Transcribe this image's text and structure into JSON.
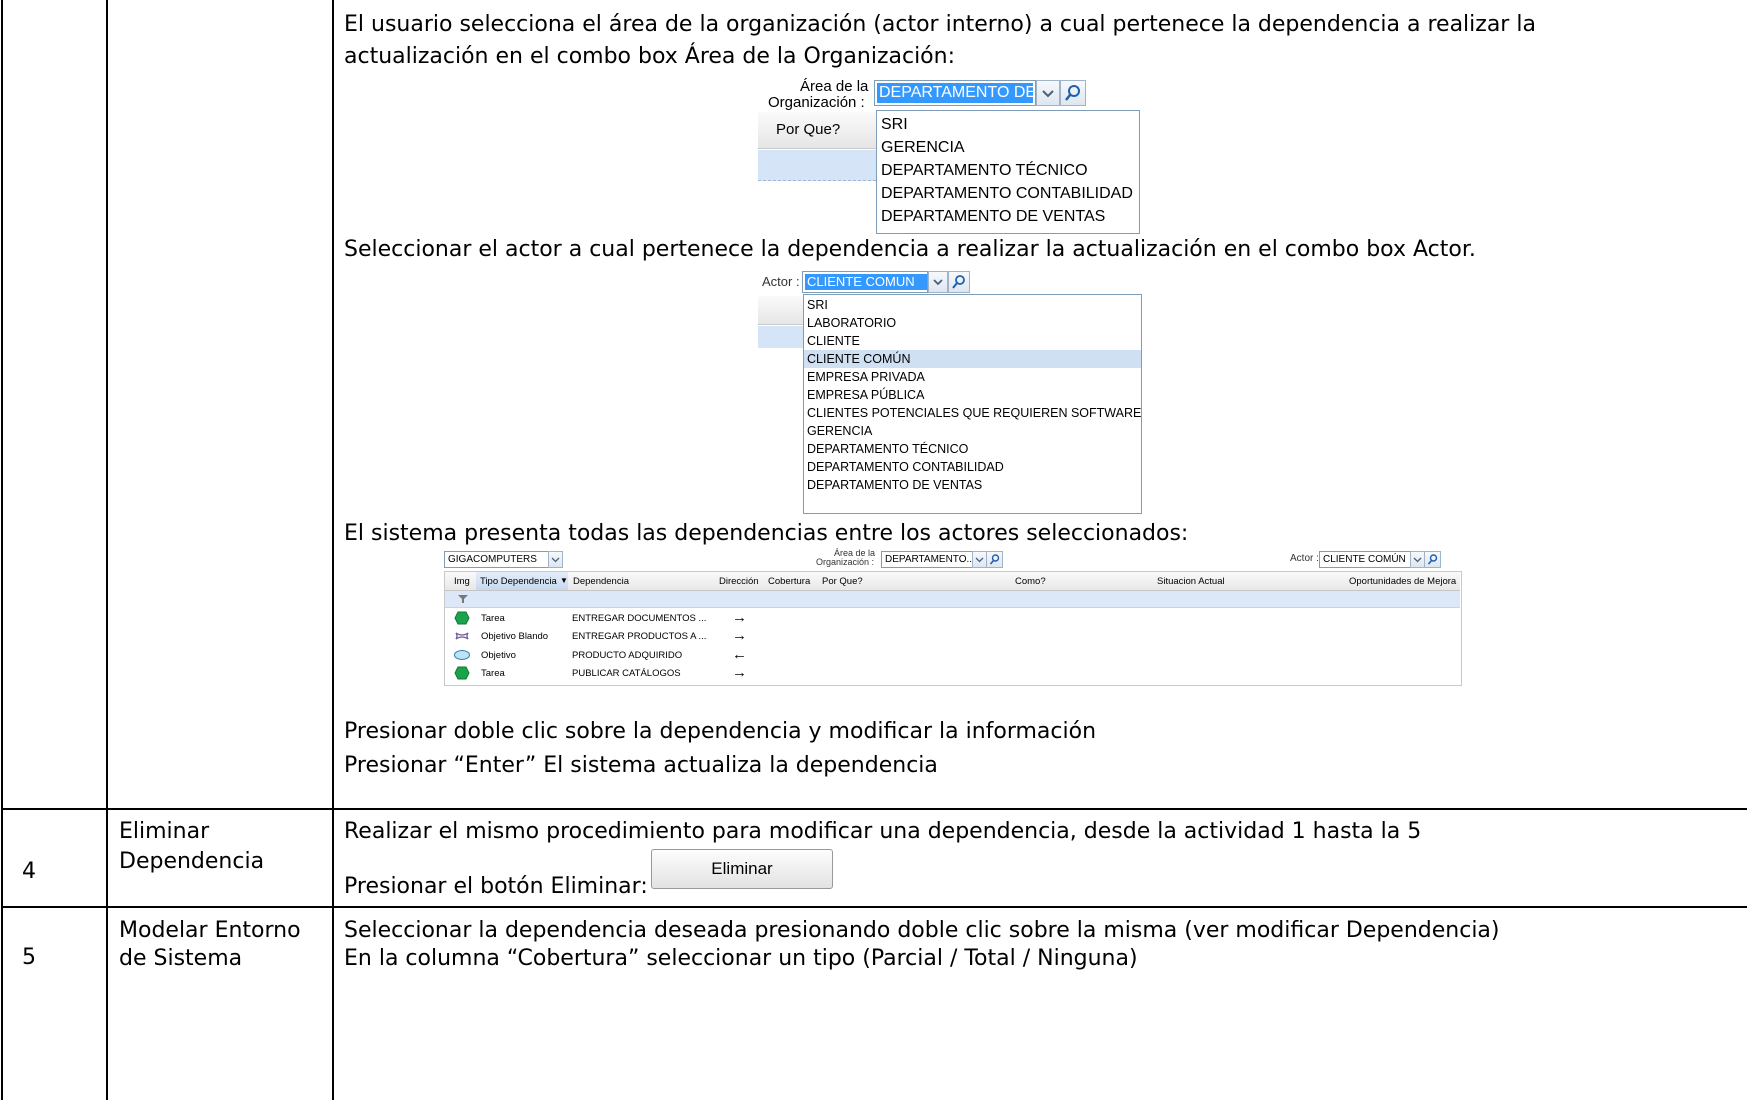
{
  "row3": {
    "para1_line1": "El usuario selecciona el área de la organización (actor interno) a cual pertenece la dependencia a realizar la",
    "para1_line2": "actualización en el combo box Área de la Organización:",
    "area_combo": {
      "label_line1": "Área de la",
      "label_line2": "Organización :",
      "value": "DEPARTAMENTO DE",
      "column_header": "Por Que?",
      "options": [
        "SRI",
        "GERENCIA",
        "DEPARTAMENTO TÉCNICO",
        "DEPARTAMENTO CONTABILIDAD",
        "DEPARTAMENTO DE VENTAS"
      ]
    },
    "para2": "Seleccionar el actor a cual pertenece la dependencia a realizar la actualización en el combo box Actor.",
    "actor_combo": {
      "label": "Actor :",
      "value": "CLIENTE COMUN",
      "options": [
        "SRI",
        "LABORATORIO",
        "CLIENTE",
        "CLIENTE COMÚN",
        "EMPRESA PRIVADA",
        "EMPRESA PÚBLICA",
        "CLIENTES POTENCIALES QUE REQUIEREN SOFTWARE",
        "GERENCIA",
        "DEPARTAMENTO TÉCNICO",
        "DEPARTAMENTO CONTABILIDAD",
        "DEPARTAMENTO DE VENTAS"
      ],
      "selected": "CLIENTE COMÚN"
    },
    "para3": "El sistema presenta todas las dependencias entre los actores seleccionados:",
    "grid": {
      "company_value": "GIGACOMPUTERS",
      "area_label_line1": "Área de la",
      "area_label_line2": "Organización :",
      "area_value": "DEPARTAMENTO...",
      "actor_label": "Actor :",
      "actor_value": "CLIENTE COMÚN",
      "columns": {
        "img": "Img",
        "tipo": "Tipo Dependencia",
        "dependencia": "Dependencia",
        "direccion": "Dirección",
        "cobertura": "Cobertura",
        "por_que": "Por Que?",
        "como": "Como?",
        "situacion": "Situacion Actual",
        "oportunidades": "Oportunidades de Mejora"
      },
      "rows": [
        {
          "icon": "hexagon-green-icon",
          "tipo": "Tarea",
          "dependencia": "ENTREGAR DOCUMENTOS ...",
          "direccion": "→"
        },
        {
          "icon": "cloud-purple-icon",
          "tipo": "Objetivo Blando",
          "dependencia": "ENTREGAR PRODUCTOS A ...",
          "direccion": "→"
        },
        {
          "icon": "ellipse-blue-icon",
          "tipo": "Objetivo",
          "dependencia": "PRODUCTO ADQUIRIDO",
          "direccion": "←"
        },
        {
          "icon": "hexagon-green-icon",
          "tipo": "Tarea",
          "dependencia": "PUBLICAR CATÁLOGOS",
          "direccion": "→"
        }
      ]
    },
    "para4": "Presionar doble clic sobre la dependencia y modificar la información",
    "para5": "Presionar “Enter” El sistema actualiza la dependencia"
  },
  "row4": {
    "number": "4",
    "activity_line1": "Eliminar",
    "activity_line2": "Dependencia",
    "para1": "Realizar el mismo procedimiento para modificar una dependencia, desde la actividad 1 hasta la 5",
    "para2": "Presionar el botón Eliminar:",
    "button": "Eliminar"
  },
  "row5": {
    "number": "5",
    "activity_line1": "Modelar Entorno",
    "activity_line2": "de Sistema",
    "para1": "Seleccionar la dependencia deseada presionando doble clic sobre la misma (ver modificar Dependencia)",
    "para2": "En la columna “Cobertura” seleccionar un tipo (Parcial / Total / Ninguna)"
  }
}
